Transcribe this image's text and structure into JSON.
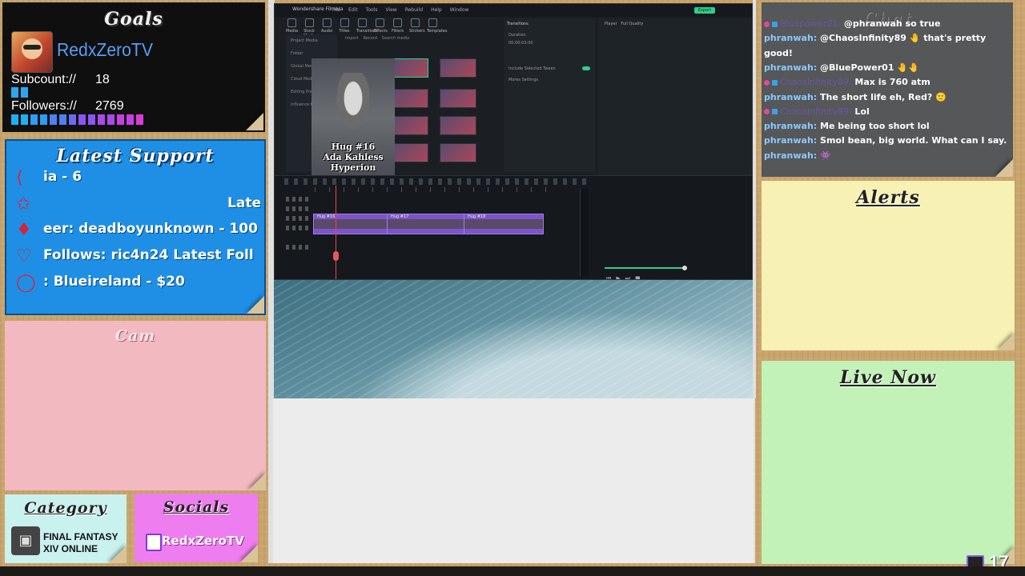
{
  "goals": {
    "title": "Goals",
    "username": "RedxZeroTV",
    "subcount_label": "Subcount://",
    "subcount_value": "18",
    "followers_label": "Followers://",
    "followers_value": "2769"
  },
  "support": {
    "title": "Latest Support",
    "rows": [
      {
        "icon": "share-icon",
        "text": "ia - 6"
      },
      {
        "icon": "star-icon",
        "text": "                        Late"
      },
      {
        "icon": "cheer-icon",
        "text": "eer: deadboyunknown - 100"
      },
      {
        "icon": "heart-icon",
        "text": "Follows: ric4n24    Latest Foll"
      },
      {
        "icon": "chat-bubble-icon",
        "text": ": Blueireland - $20"
      }
    ]
  },
  "cam": {
    "title": "Cam"
  },
  "category": {
    "title": "Category",
    "line1": "FINAL FANTASY",
    "line2": "XIV ONLINE"
  },
  "socials": {
    "title": "Socials",
    "handle": "RedxZeroTV"
  },
  "editor": {
    "window_title": "Wondershare Filmora",
    "menu": [
      "File",
      "Edit",
      "Tools",
      "View",
      "Rebuild",
      "Help",
      "Window"
    ],
    "export_label": "Export",
    "tool_tabs": [
      "Media",
      "Stock Media",
      "Audio",
      "Titles",
      "Transitions",
      "Effects",
      "Filters",
      "Stickers",
      "Templates"
    ],
    "media_side": [
      "Project Media",
      "Folder",
      "Global Media",
      "Cloud Media",
      "Editing Presets",
      "Influence Kit"
    ],
    "media_top": [
      "Import",
      "Record",
      "Search media"
    ],
    "import_label": "Import Media",
    "player_label": "Player",
    "player_quality": "Full Quality",
    "props": {
      "tab": "Transitions",
      "duration": "Duration",
      "duration_val": "00:00:03:00",
      "include": "Include Selected Tween",
      "more": "Mores Settings"
    },
    "preview_caption": [
      "Hug #16",
      "Ada Kahless",
      "Hyperion"
    ],
    "clip_labels": [
      "Hug #16",
      "Hug #17",
      "Hug #18"
    ]
  },
  "chat": {
    "title": "Chat",
    "messages": [
      {
        "user": "Bluepower01:",
        "dim": true,
        "text": "@phranwah so true"
      },
      {
        "user": "phranwah:",
        "dim": false,
        "text": "@ChaosInfinity89 🤚 that's pretty"
      },
      {
        "user": "",
        "dim": false,
        "text": "good!"
      },
      {
        "user": "phranwah:",
        "dim": false,
        "text": "@BluePower01 🤚🤚"
      },
      {
        "user": "ChaosInfinity89:",
        "dim": true,
        "text": "Max is 760 atm"
      },
      {
        "user": "phranwah:",
        "dim": false,
        "text": "The short life eh, Red? 🙂"
      },
      {
        "user": "ChaosInfinity89:",
        "dim": true,
        "text": "Lol"
      },
      {
        "user": "phranwah:",
        "dim": false,
        "text": "Me being too short lol"
      },
      {
        "user": "phranwah:",
        "dim": false,
        "text": "Smol bean, big world. What can I say."
      },
      {
        "user": "phranwah:",
        "dim": false,
        "text": "👾"
      }
    ]
  },
  "alerts": {
    "title": "Alerts"
  },
  "livenow": {
    "title": "Live Now"
  },
  "viewers": {
    "count": "17"
  },
  "colors": {
    "goal_bar_sub": "#29a8f0",
    "goal_bar_follow": [
      "#1fb0f0",
      "#2e9cf2",
      "#4a83f0",
      "#6a6af0",
      "#8a55f0",
      "#a84ae8",
      "#c440e0",
      "#d83cd8"
    ]
  }
}
